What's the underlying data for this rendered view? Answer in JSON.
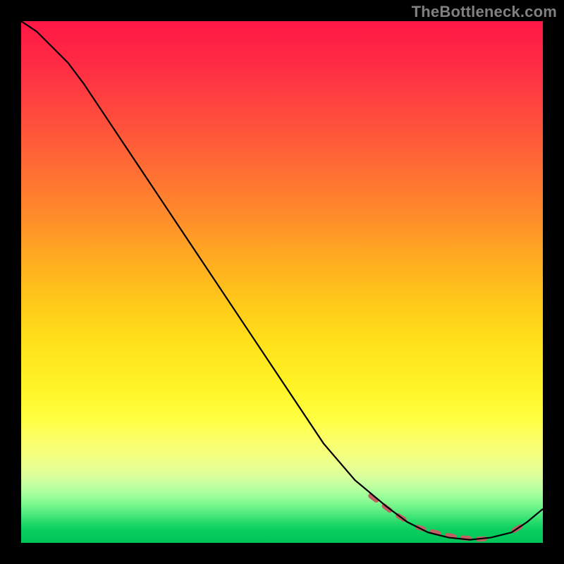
{
  "watermark": "TheBottleneck.com",
  "chart_data": {
    "type": "line",
    "title": "",
    "xlabel": "",
    "ylabel": "",
    "xlim": [
      0,
      100
    ],
    "ylim": [
      0,
      100
    ],
    "series": [
      {
        "name": "main-curve",
        "color": "#000000",
        "stroke_width": 2,
        "x": [
          0,
          3,
          6,
          9,
          12,
          16,
          20,
          26,
          34,
          42,
          50,
          58,
          64,
          70,
          74,
          78,
          82,
          86,
          90,
          94,
          97,
          100
        ],
        "y": [
          100,
          98,
          95,
          92,
          88,
          82,
          76,
          67,
          55,
          43,
          31,
          19,
          12,
          7,
          4,
          2,
          1,
          0.6,
          1,
          2,
          4,
          6.5
        ]
      },
      {
        "name": "dash-segment-fall",
        "color": "#c16163",
        "stroke_width": 7,
        "dashed": true,
        "x": [
          67,
          71,
          75
        ],
        "y": [
          9,
          6,
          3.5
        ]
      },
      {
        "name": "dash-segment-floor",
        "color": "#c16163",
        "stroke_width": 7,
        "dashed": true,
        "x": [
          76,
          80,
          84,
          88,
          90
        ],
        "y": [
          3.0,
          1.8,
          1.0,
          0.7,
          0.9
        ]
      },
      {
        "name": "dash-segment-rise",
        "color": "#c16163",
        "stroke_width": 7,
        "dashed": true,
        "x": [
          94.5,
          96.5
        ],
        "y": [
          2.4,
          3.6
        ]
      }
    ],
    "gradient_stops": [
      {
        "pos": 0.0,
        "color": "#ff1846"
      },
      {
        "pos": 0.5,
        "color": "#ffc91a"
      },
      {
        "pos": 0.78,
        "color": "#ffff3f"
      },
      {
        "pos": 0.9,
        "color": "#b0ff9f"
      },
      {
        "pos": 1.0,
        "color": "#00c459"
      }
    ]
  }
}
